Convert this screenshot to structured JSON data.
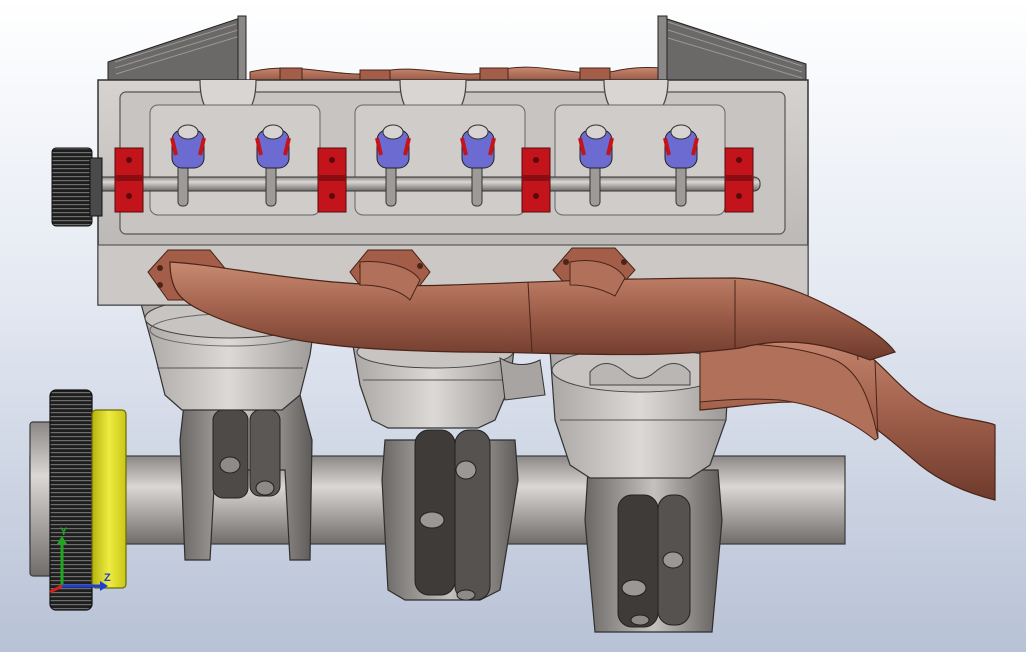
{
  "viewport": {
    "background_top": "#ffffff",
    "background_bottom": "#b8c2d6"
  },
  "model": {
    "colors": {
      "casting": "#c9c6c4",
      "casting_dark": "#7d7a78",
      "exhaust": "#a8644f",
      "exhaust_dark": "#6e3a2c",
      "rocker_red": "#c4141b",
      "rocker_blue": "#6a6ad0",
      "pulley_yellow": "#e2df1e",
      "pulley_dark": "#2b2b2b"
    }
  },
  "triad": {
    "x_label": "",
    "y_label": "Y",
    "z_label": "Z",
    "x_color": "#d21f1f",
    "y_color": "#1fa81f",
    "z_color": "#1f3fd2"
  }
}
